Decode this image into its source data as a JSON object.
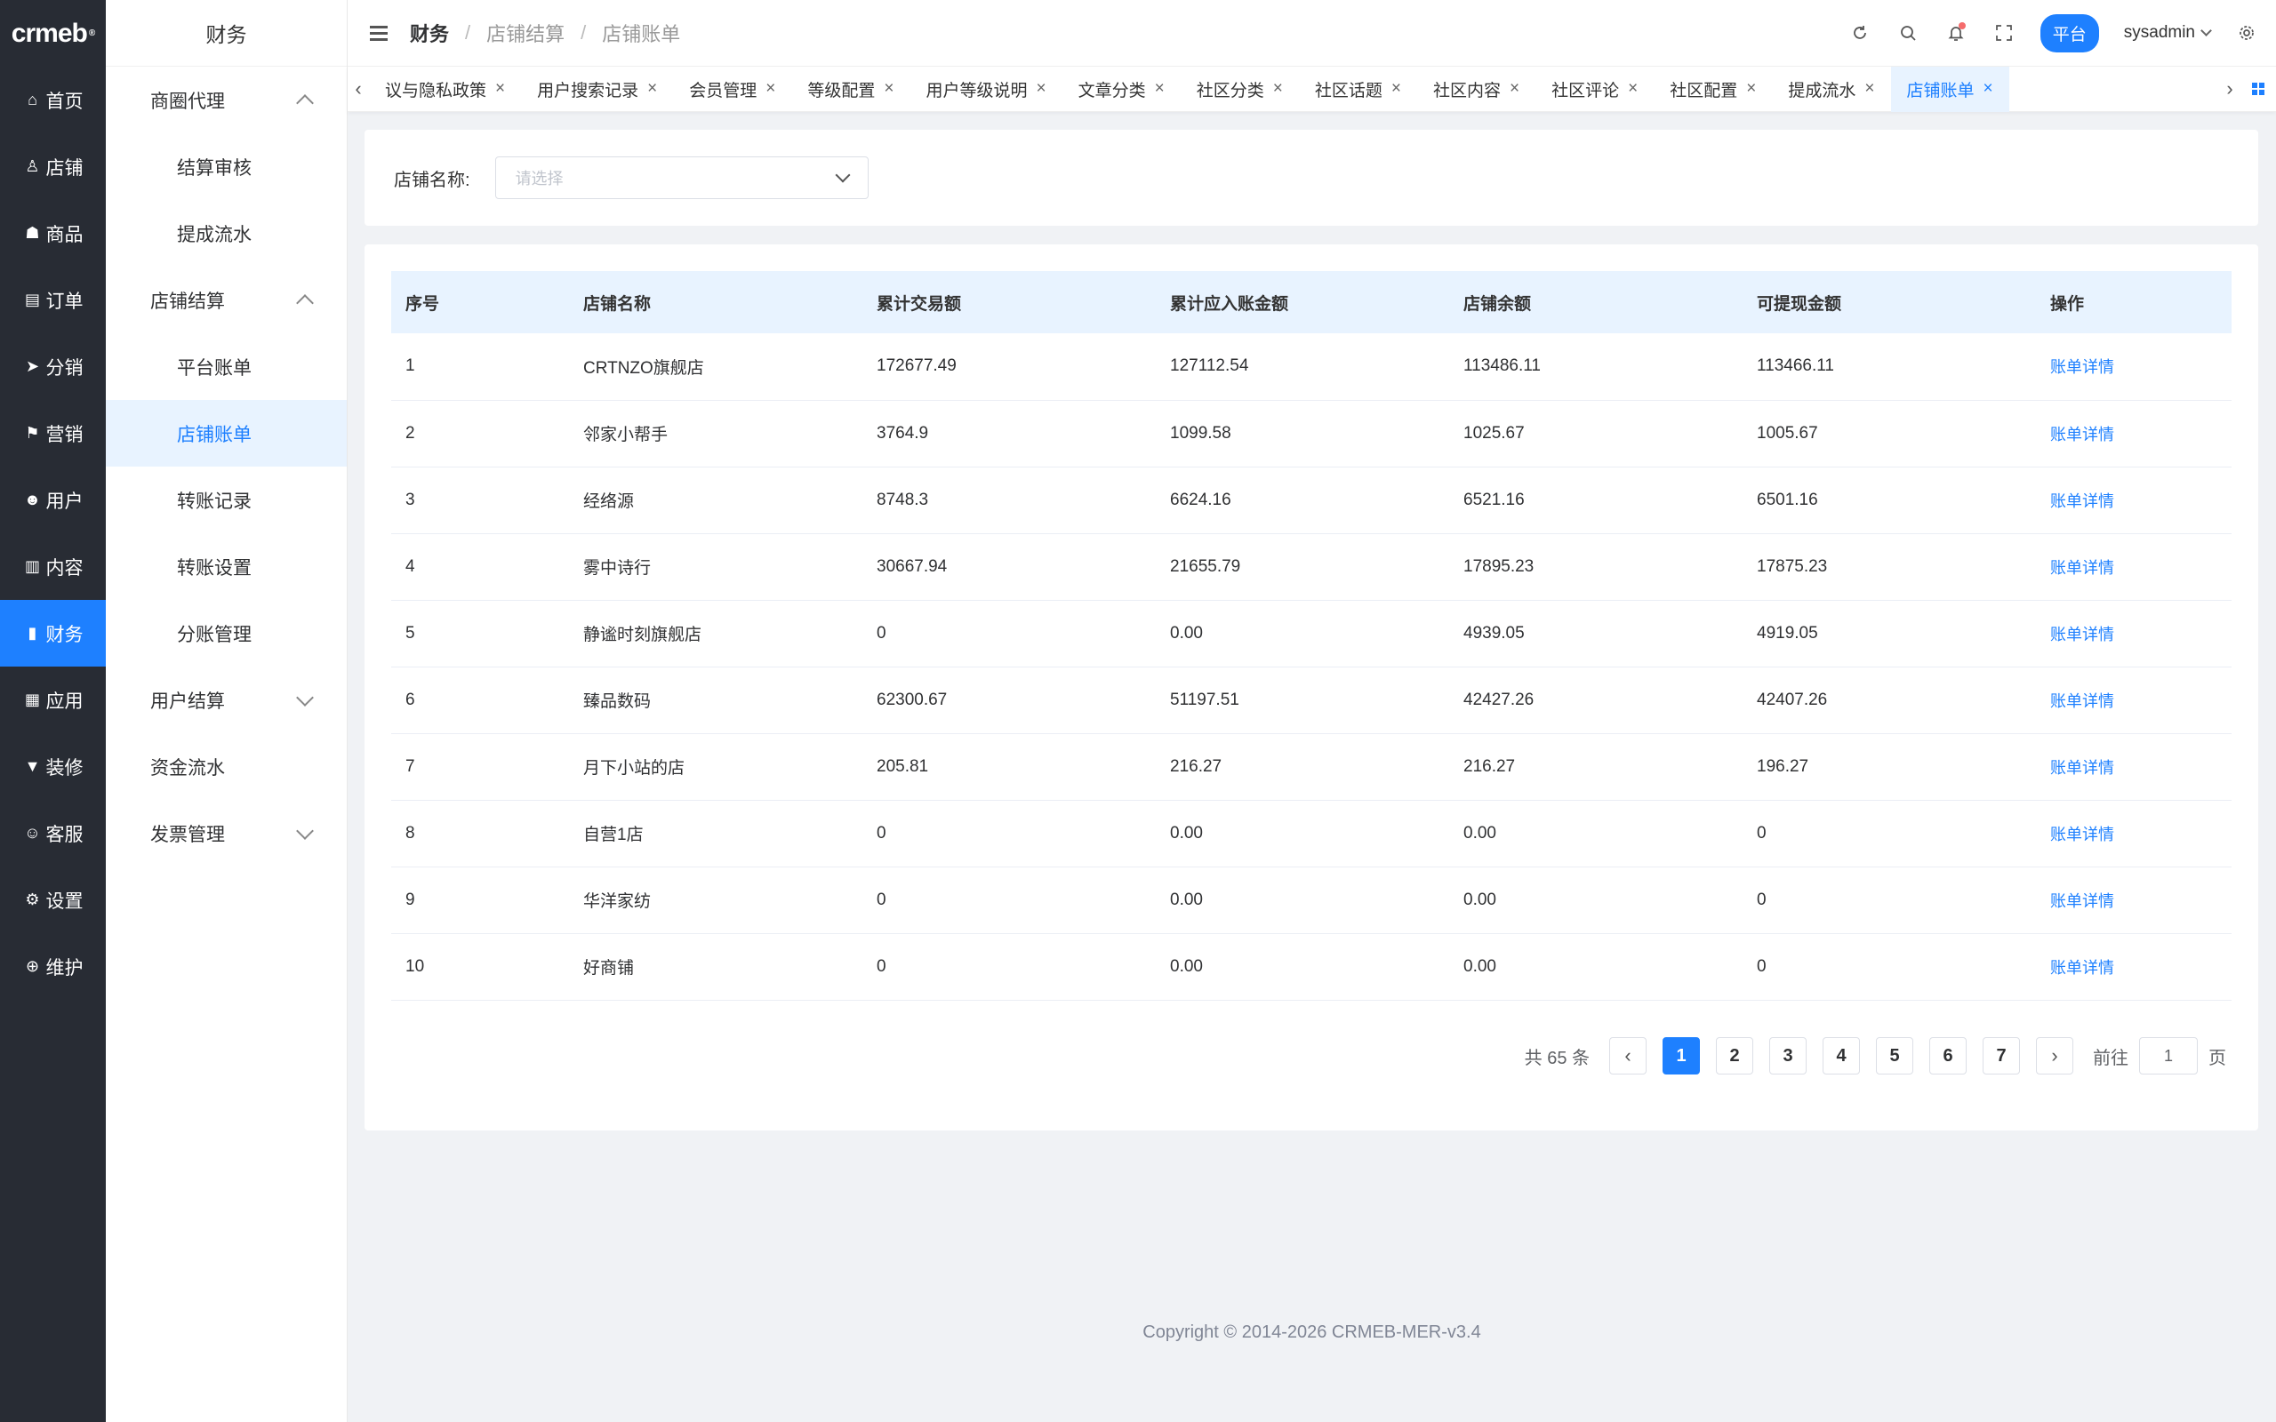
{
  "brand": {
    "logo": "crmeb",
    "logo_mark": "®"
  },
  "rail": [
    {
      "label": "首页",
      "icon": "home-icon",
      "glyph": "⌂"
    },
    {
      "label": "店铺",
      "icon": "store-icon",
      "glyph": "♙"
    },
    {
      "label": "商品",
      "icon": "bag-icon",
      "glyph": "☗"
    },
    {
      "label": "订单",
      "icon": "clipboard-icon",
      "glyph": "▤"
    },
    {
      "label": "分销",
      "icon": "send-icon",
      "glyph": "➤"
    },
    {
      "label": "营销",
      "icon": "flag-icon",
      "glyph": "⚑"
    },
    {
      "label": "用户",
      "icon": "user-icon",
      "glyph": "☻"
    },
    {
      "label": "内容",
      "icon": "book-icon",
      "glyph": "▥"
    },
    {
      "label": "财务",
      "icon": "bar-chart-icon",
      "glyph": "▮"
    },
    {
      "label": "应用",
      "icon": "grid-icon",
      "glyph": "▦"
    },
    {
      "label": "装修",
      "icon": "paint-icon",
      "glyph": "▼"
    },
    {
      "label": "客服",
      "icon": "service-icon",
      "glyph": "☺"
    },
    {
      "label": "设置",
      "icon": "gear-icon",
      "glyph": "⚙"
    },
    {
      "label": "维护",
      "icon": "tool-icon",
      "glyph": "⊕"
    }
  ],
  "submenu": {
    "title": "财务",
    "groups": [
      {
        "label": "商圈代理",
        "expanded": true,
        "items": [
          "结算审核",
          "提成流水"
        ]
      },
      {
        "label": "店铺结算",
        "expanded": true,
        "items": [
          "平台账单",
          "店铺账单",
          "转账记录",
          "转账设置",
          "分账管理"
        ]
      },
      {
        "label": "用户结算",
        "expanded": false,
        "items": []
      },
      {
        "label": "资金流水",
        "expanded": null,
        "items": []
      },
      {
        "label": "发票管理",
        "expanded": false,
        "items": []
      }
    ],
    "active_item": "店铺账单"
  },
  "header": {
    "breadcrumb": [
      "财务",
      "店铺结算",
      "店铺账单"
    ],
    "platform_button": "平台",
    "username": "sysadmin"
  },
  "tabs": [
    "议与隐私政策",
    "用户搜索记录",
    "会员管理",
    "等级配置",
    "用户等级说明",
    "文章分类",
    "社区分类",
    "社区话题",
    "社区内容",
    "社区评论",
    "社区配置",
    "提成流水",
    "店铺账单"
  ],
  "active_tab": "店铺账单",
  "search": {
    "label": "店铺名称:",
    "placeholder": "请选择"
  },
  "table": {
    "columns": [
      "序号",
      "店铺名称",
      "累计交易额",
      "累计应入账金额",
      "店铺余额",
      "可提现金额",
      "操作"
    ],
    "rows": [
      [
        "1",
        "CRTNZO旗舰店",
        "172677.49",
        "127112.54",
        "113486.11",
        "113466.11",
        "账单详情"
      ],
      [
        "2",
        "邻家小帮手",
        "3764.9",
        "1099.58",
        "1025.67",
        "1005.67",
        "账单详情"
      ],
      [
        "3",
        "经络源",
        "8748.3",
        "6624.16",
        "6521.16",
        "6501.16",
        "账单详情"
      ],
      [
        "4",
        "雾中诗行",
        "30667.94",
        "21655.79",
        "17895.23",
        "17875.23",
        "账单详情"
      ],
      [
        "5",
        "静谧时刻旗舰店",
        "0",
        "0.00",
        "4939.05",
        "4919.05",
        "账单详情"
      ],
      [
        "6",
        "臻品数码",
        "62300.67",
        "51197.51",
        "42427.26",
        "42407.26",
        "账单详情"
      ],
      [
        "7",
        "月下小站的店",
        "205.81",
        "216.27",
        "216.27",
        "196.27",
        "账单详情"
      ],
      [
        "8",
        "自营1店",
        "0",
        "0.00",
        "0.00",
        "0",
        "账单详情"
      ],
      [
        "9",
        "华洋家纺",
        "0",
        "0.00",
        "0.00",
        "0",
        "账单详情"
      ],
      [
        "10",
        "好商铺",
        "0",
        "0.00",
        "0.00",
        "0",
        "账单详情"
      ]
    ]
  },
  "pagination": {
    "total_text": "共 65 条",
    "pages": [
      "1",
      "2",
      "3",
      "4",
      "5",
      "6",
      "7"
    ],
    "current": "1",
    "goto_label": "前往",
    "goto_value": "1",
    "page_unit": "页"
  },
  "footer": "Copyright © 2014-2026 CRMEB-MER-v3.4",
  "colors": {
    "accent": "#1e80ff",
    "rail_bg": "#282c34",
    "active_bg": "#e8f3ff"
  }
}
